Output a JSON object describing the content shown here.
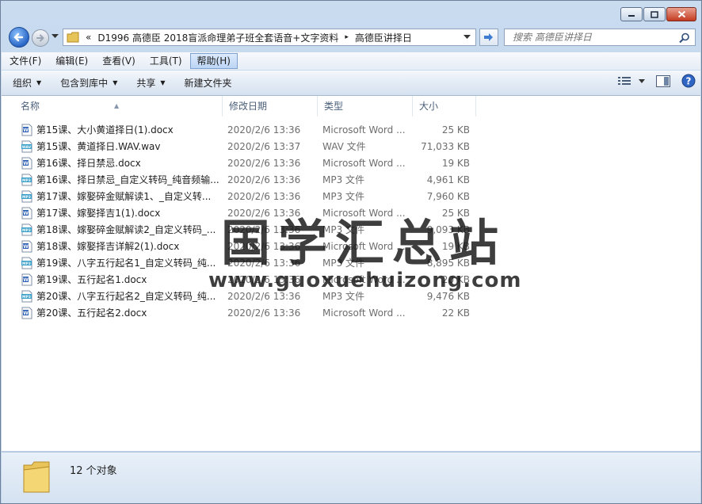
{
  "address": {
    "back_glyph": "«",
    "crumbs": [
      "D1996 高德臣 2018盲派命理弟子班全套语音+文字资料",
      "高德臣讲择日"
    ],
    "separator": "▸"
  },
  "search": {
    "placeholder": "搜索 高德臣讲择日"
  },
  "menu": [
    "文件(F)",
    "编辑(E)",
    "查看(V)",
    "工具(T)",
    "帮助(H)"
  ],
  "menu_active_index": 4,
  "toolbar": {
    "organize": "组织",
    "include_library": "包含到库中",
    "share": "共享",
    "new_folder": "新建文件夹"
  },
  "columns": {
    "name": "名称",
    "date": "修改日期",
    "type": "类型",
    "size": "大小"
  },
  "files": [
    {
      "name": "第15课、大小黄道择日(1).docx",
      "date": "2020/2/6 13:36",
      "type": "Microsoft Word ...",
      "size": "25 KB",
      "icon": "word-doc-icon"
    },
    {
      "name": "第15课、黄道择日.WAV.wav",
      "date": "2020/2/6 13:37",
      "type": "WAV 文件",
      "size": "71,033 KB",
      "icon": "wav-audio-icon"
    },
    {
      "name": "第16课、择日禁忌.docx",
      "date": "2020/2/6 13:36",
      "type": "Microsoft Word ...",
      "size": "19 KB",
      "icon": "word-doc-icon"
    },
    {
      "name": "第16课、择日禁忌_自定义转码_纯音频输...",
      "date": "2020/2/6 13:36",
      "type": "MP3 文件",
      "size": "4,961 KB",
      "icon": "mp3-audio-icon"
    },
    {
      "name": "第17课、嫁娶碎金赋解读1、_自定义转...",
      "date": "2020/2/6 13:36",
      "type": "MP3 文件",
      "size": "7,960 KB",
      "icon": "mp3-audio-icon"
    },
    {
      "name": "第17课、嫁娶择吉1(1).docx",
      "date": "2020/2/6 13:36",
      "type": "Microsoft Word ...",
      "size": "25 KB",
      "icon": "word-doc-icon"
    },
    {
      "name": "第18课、嫁娶碎金赋解读2_自定义转码_...",
      "date": "2020/2/6 13:36",
      "type": "MP3 文件",
      "size": "9,093 KB",
      "icon": "mp3-audio-icon"
    },
    {
      "name": "第18课、嫁娶择吉详解2(1).docx",
      "date": "2020/2/6 13:36",
      "type": "Microsoft Word ...",
      "size": "19 KB",
      "icon": "word-doc-icon"
    },
    {
      "name": "第19课、八字五行起名1_自定义转码_纯...",
      "date": "2020/2/6 13:36",
      "type": "MP3 文件",
      "size": "8,895 KB",
      "icon": "mp3-audio-icon"
    },
    {
      "name": "第19课、五行起名1.docx",
      "date": "2020/2/6 13:36",
      "type": "Microsoft Word ...",
      "size": "20 KB",
      "icon": "word-doc-icon"
    },
    {
      "name": "第20课、八字五行起名2_自定义转码_纯...",
      "date": "2020/2/6 13:36",
      "type": "MP3 文件",
      "size": "9,476 KB",
      "icon": "mp3-audio-icon"
    },
    {
      "name": "第20课、五行起名2.docx",
      "date": "2020/2/6 13:36",
      "type": "Microsoft Word ...",
      "size": "22 KB",
      "icon": "word-doc-icon"
    }
  ],
  "watermark": {
    "text_cn": "国学汇总站",
    "url": "www.guoxuehuizong.com"
  },
  "status": {
    "count": "12 个对象"
  }
}
